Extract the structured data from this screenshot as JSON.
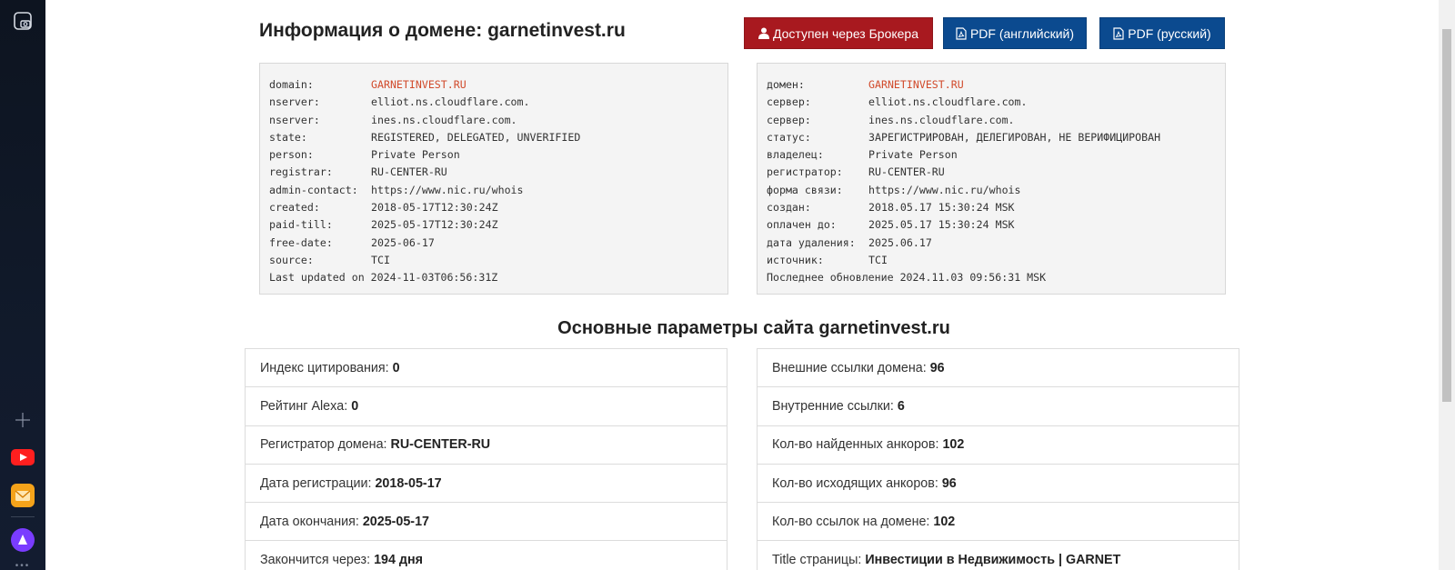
{
  "header": {
    "title_prefix": "Информация о домене:",
    "title_domain": "garnetinvest.ru"
  },
  "buttons": {
    "broker": "Доступен через Брокера",
    "pdf_en": "PDF (английский)",
    "pdf_ru": "PDF (русский)"
  },
  "whois_en": [
    {
      "key": "domain:",
      "value": "GARNETINVEST.RU",
      "highlight": true
    },
    {
      "key": "nserver:",
      "value": "elliot.ns.cloudflare.com."
    },
    {
      "key": "nserver:",
      "value": "ines.ns.cloudflare.com."
    },
    {
      "key": "state:",
      "value": "REGISTERED, DELEGATED, UNVERIFIED"
    },
    {
      "key": "person:",
      "value": "Private Person"
    },
    {
      "key": "registrar:",
      "value": "RU-CENTER-RU"
    },
    {
      "key": "admin-contact:",
      "value": "https://www.nic.ru/whois"
    },
    {
      "key": "created:",
      "value": "2018-05-17T12:30:24Z"
    },
    {
      "key": "paid-till:",
      "value": "2025-05-17T12:30:24Z"
    },
    {
      "key": "free-date:",
      "value": "2025-06-17"
    },
    {
      "key": "source:",
      "value": "TCI"
    }
  ],
  "whois_en_updated": "Last updated on 2024-11-03T06:56:31Z",
  "whois_ru": [
    {
      "key": "домен:",
      "value": "GARNETINVEST.RU",
      "highlight": true
    },
    {
      "key": "сервер:",
      "value": "elliot.ns.cloudflare.com."
    },
    {
      "key": "сервер:",
      "value": "ines.ns.cloudflare.com."
    },
    {
      "key": "статус:",
      "value": "ЗАРЕГИСТРИРОВАН, ДЕЛЕГИРОВАН, НЕ ВЕРИФИЦИРОВАН"
    },
    {
      "key": "владелец:",
      "value": "Private Person"
    },
    {
      "key": "регистратор:",
      "value": "RU-CENTER-RU"
    },
    {
      "key": "форма связи:",
      "value": "https://www.nic.ru/whois"
    },
    {
      "key": "создан:",
      "value": "2018.05.17 15:30:24 MSK"
    },
    {
      "key": "оплачен до:",
      "value": "2025.05.17 15:30:24 MSK"
    },
    {
      "key": "дата удаления:",
      "value": "2025.06.17"
    },
    {
      "key": "источник:",
      "value": "TCI"
    }
  ],
  "whois_ru_updated": "Последнее обновление 2024.11.03 09:56:31 MSK",
  "section_title": "Основные параметры сайта garnetinvest.ru",
  "params_left": [
    {
      "label": "Индекс цитирования:",
      "value": "0"
    },
    {
      "label": "Рейтинг Alexa:",
      "value": "0"
    },
    {
      "label": "Регистратор домена:",
      "value": "RU-CENTER-RU"
    },
    {
      "label": "Дата регистрации:",
      "value": "2018-05-17"
    },
    {
      "label": "Дата окончания:",
      "value": "2025-05-17"
    },
    {
      "label": "Закончится через:",
      "value": "194 дня"
    }
  ],
  "params_right": [
    {
      "label": "Внешние ссылки домена:",
      "value": "96"
    },
    {
      "label": "Внутренние ссылки:",
      "value": "6"
    },
    {
      "label": "Кол-во найденных анкоров:",
      "value": "102"
    },
    {
      "label": "Кол-во исходящих анкоров:",
      "value": "96"
    },
    {
      "label": "Кол-во ссылок на домене:",
      "value": "102"
    },
    {
      "label": "Title страницы:",
      "value": "Инвестиции в Недвижимость | GARNET"
    }
  ],
  "colors": {
    "broker_button": "#a8191f",
    "pdf_button": "#0b4a8f",
    "domain_highlight": "#d14a2b"
  },
  "sidebar_icons": [
    "screenshot-icon",
    "plus-icon",
    "youtube-icon",
    "mail-icon",
    "alice-icon",
    "more-icon"
  ]
}
